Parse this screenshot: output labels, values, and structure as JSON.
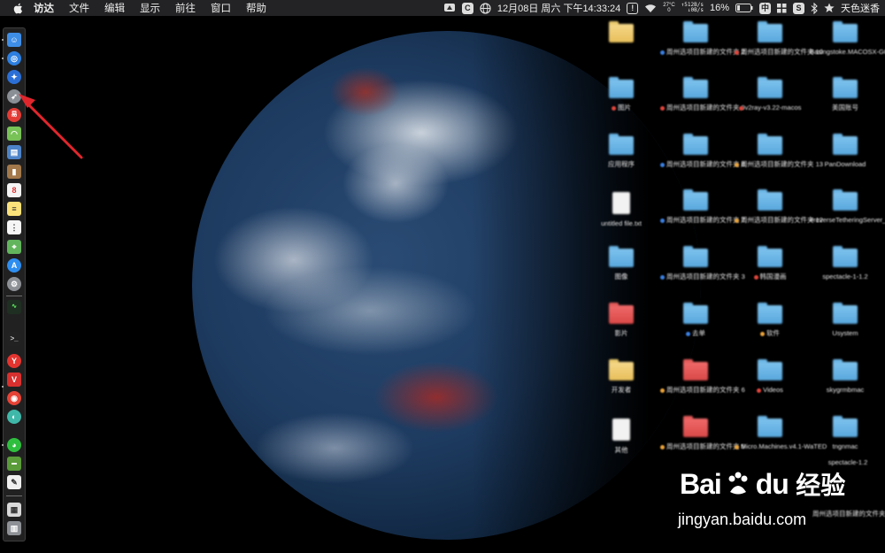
{
  "menubar": {
    "app_name": "访达",
    "items": [
      "文件",
      "编辑",
      "显示",
      "前往",
      "窗口",
      "帮助"
    ],
    "clock": "12月08日 周六 下午14:33:24",
    "temp_top": "27°C",
    "temp_bottom": "0",
    "net_up": "↑512B/s",
    "net_down": "↓0B/s",
    "battery": "16%",
    "input_method": "中",
    "user": "天色迷香"
  },
  "desktop": {
    "columns": [
      [
        {
          "label": "",
          "kind": "yellow"
        },
        {
          "label": "图片",
          "kind": "blue",
          "tag": "#e0453b"
        },
        {
          "label": "应用程序",
          "kind": "blue"
        },
        {
          "label": "untitled file.txt",
          "kind": "doc"
        },
        {
          "label": "图像",
          "kind": "blue"
        },
        {
          "label": "影片",
          "kind": "red"
        },
        {
          "label": "开发者",
          "kind": "yellow"
        },
        {
          "label": "其他",
          "kind": "doc"
        }
      ],
      [
        {
          "label": "周州选项目新建的文件夹 2",
          "kind": "blue",
          "tag": "#3a7fe0"
        },
        {
          "label": "周州选项目新建的文件夹 9",
          "kind": "blue",
          "tag": "#e0453b"
        },
        {
          "label": "周州选项目新建的文件夹 8",
          "kind": "blue",
          "tag": "#3a7fe0"
        },
        {
          "label": "周州选项目新建的文件夹 7",
          "kind": "blue",
          "tag": "#3a7fe0"
        },
        {
          "label": "周州选项目新建的文件夹 3",
          "kind": "blue",
          "tag": "#3a7fe0"
        },
        {
          "label": "去单",
          "kind": "blue",
          "tag": "#3a7fe0"
        },
        {
          "label": "周州选项目新建的文件夹 6",
          "kind": "red",
          "tag": "#e8a23a"
        },
        {
          "label": "周州选项目新建的文件夹 5",
          "kind": "red",
          "tag": "#e8a23a"
        }
      ],
      [
        {
          "label": "周州选项目新建的文件夹 10",
          "kind": "blue",
          "tag": "#e0453b"
        },
        {
          "label": "v2ray-v3.22-macos",
          "kind": "blue",
          "tag": "#e0453b"
        },
        {
          "label": "周州选项目新建的文件夹 13",
          "kind": "blue",
          "tag": "#e8a23a"
        },
        {
          "label": "周州选项目新建的文件夹 12",
          "kind": "blue",
          "tag": "#e8a23a"
        },
        {
          "label": "韩国漫画",
          "kind": "blue",
          "tag": "#e0453b"
        },
        {
          "label": "软件",
          "kind": "blue",
          "tag": "#e8a23a"
        },
        {
          "label": "Videos",
          "kind": "blue",
          "tag": "#e0453b"
        },
        {
          "label": "Micro.Machines.v4.1-WaTED",
          "kind": "blue",
          "tag": "#e8a23a"
        }
      ],
      [
        {
          "label": "Basingstoke.MACOSX-GOG",
          "kind": "blue"
        },
        {
          "label": "美国账号",
          "kind": "blue"
        },
        {
          "label": "PanDownload",
          "kind": "blue"
        },
        {
          "label": "#reverseTetheringServer_1.2.0",
          "kind": "blue"
        },
        {
          "label": "spectacle-1-1.2",
          "kind": "blue"
        },
        {
          "label": "Usystem",
          "kind": "blue"
        },
        {
          "label": "skygrmbmac",
          "kind": "blue"
        },
        {
          "label": "tngnmac",
          "kind": "blue"
        }
      ]
    ],
    "extra_labels": [
      "spectacle-1.2",
      "周州选项目新建的文件夹 14"
    ]
  },
  "watermark": {
    "logo_text": "Bai",
    "logo_text2": "du",
    "cn_text": "经验",
    "url": "jingyan.baidu.com"
  },
  "colors": {
    "menubar_bg": "#232325",
    "arrow": "#e0262d",
    "folder_blue": "#58a7dd"
  }
}
